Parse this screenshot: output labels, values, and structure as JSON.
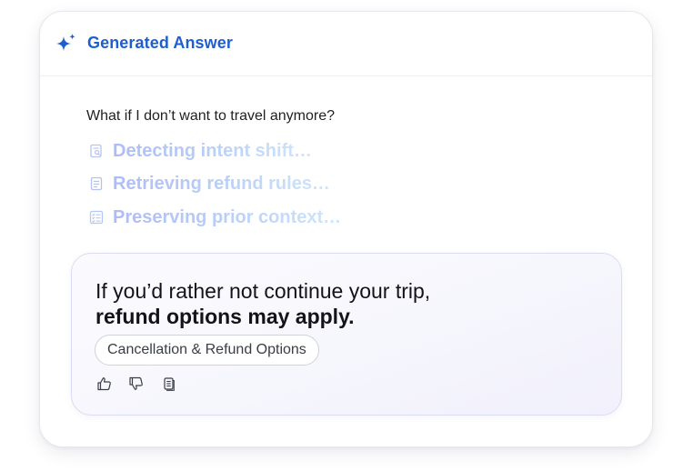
{
  "header": {
    "title": "Generated Answer",
    "icon": "sparkle-icon",
    "accent_color": "#1e5fd0"
  },
  "question": "What if I don’t want to travel anymore?",
  "steps": [
    {
      "label": "Detecting intent shift…",
      "icon": "document-search-icon"
    },
    {
      "label": "Retrieving refund rules…",
      "icon": "document-icon"
    },
    {
      "label": "Preserving prior context…",
      "icon": "checklist-icon"
    }
  ],
  "answer": {
    "line1": "If you’d rather not continue your trip,",
    "line2": "refund options may apply.",
    "chip_label": "Cancellation & Refund Options",
    "feedback_icons": [
      "thumbs-up-icon",
      "thumbs-down-icon",
      "copy-icon"
    ]
  }
}
